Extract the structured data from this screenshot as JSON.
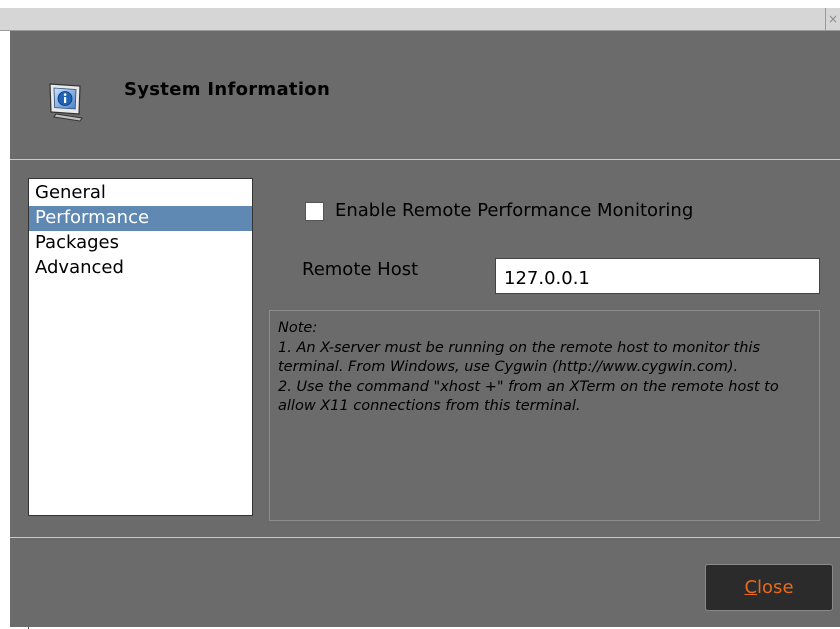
{
  "window": {
    "close_glyph": "×"
  },
  "header": {
    "title": "System Information",
    "icon": "info-monitor-icon"
  },
  "nav": {
    "items": [
      {
        "label": "General",
        "selected": false
      },
      {
        "label": "Performance",
        "selected": true
      },
      {
        "label": "Packages",
        "selected": false
      },
      {
        "label": "Advanced",
        "selected": false
      }
    ]
  },
  "performance": {
    "enable_label": "Enable Remote Performance Monitoring",
    "enable_checked": false,
    "host_label": "Remote Host",
    "host_value": "127.0.0.1",
    "note": "Note:\n1. An X-server must be running on the remote host to monitor this terminal. From Windows, use Cygwin (http://www.cygwin.com).\n2. Use the command \"xhost +\" from an XTerm on the remote host to allow X11 connections from this terminal."
  },
  "footer": {
    "close_mnemonic": "C",
    "close_rest": "lose"
  },
  "colors": {
    "dialog_bg": "#6b6b6b",
    "selection": "#5f89b2",
    "close_text": "#e66a1f"
  }
}
